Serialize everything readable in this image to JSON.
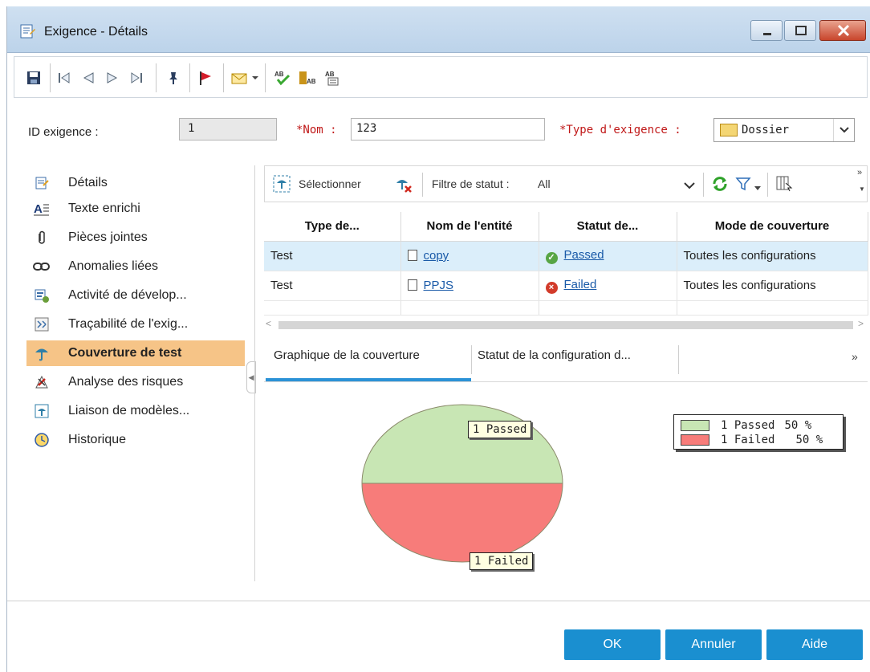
{
  "window": {
    "title": "Exigence - Détails",
    "buttons": [
      "minimize",
      "maximize",
      "close"
    ]
  },
  "toolbar": {
    "icons": [
      "save-icon",
      "first-icon",
      "previous-icon",
      "next-icon",
      "last-icon",
      "pin-icon",
      "flag-icon",
      "mail-icon",
      "spell-check-icon",
      "thesaurus-icon",
      "spell-options-icon"
    ]
  },
  "fields": {
    "id_label": "ID exigence :",
    "id_value": "1",
    "nom_label": "*Nom :",
    "nom_value": "123",
    "type_label": "*Type d'exigence :",
    "type_value": "Dossier"
  },
  "sidebar": {
    "items": [
      {
        "label": "Détails",
        "icon": "details-icon"
      },
      {
        "label": "Texte enrichi",
        "icon": "rich-text-icon"
      },
      {
        "label": "Pièces jointes",
        "icon": "paperclip-icon"
      },
      {
        "label": "Anomalies liées",
        "icon": "linked-defects-icon"
      },
      {
        "label": "Activité de dévelop...",
        "icon": "dev-activity-icon"
      },
      {
        "label": "Traçabilité de l'exig...",
        "icon": "traceability-icon"
      },
      {
        "label": "Couverture de test",
        "icon": "test-coverage-icon"
      },
      {
        "label": "Analyse des risques",
        "icon": "risk-analysis-icon"
      },
      {
        "label": "Liaison de modèles...",
        "icon": "model-link-icon"
      },
      {
        "label": "Historique",
        "icon": "history-icon"
      }
    ],
    "active_index": 6
  },
  "coverage_toolbar": {
    "select_label": "Sélectionner",
    "filter_label": "Filtre de statut :",
    "filter_value": "All"
  },
  "grid": {
    "headers": [
      "Type de...",
      "Nom de l'entité",
      "Statut de...",
      "Mode de couverture"
    ],
    "rows": [
      {
        "type": "Test",
        "name": "copy",
        "status": "Passed",
        "mode": "Toutes les configurations"
      },
      {
        "type": "Test",
        "name": "PPJS",
        "status": "Failed",
        "mode": "Toutes les configurations"
      }
    ]
  },
  "tabs": {
    "items": [
      "Graphique de la couverture",
      "Statut de la configuration d..."
    ],
    "active_index": 0
  },
  "chart_data": {
    "type": "pie",
    "labels": [
      "Passed",
      "Failed"
    ],
    "values": [
      1,
      1
    ],
    "percent": [
      50,
      50
    ],
    "slice_labels": [
      "1 Passed",
      "1 Failed"
    ],
    "legend": [
      {
        "text": "1 Passed",
        "pct": "50 %"
      },
      {
        "text": "1 Failed",
        "pct": "50 %"
      }
    ],
    "colors": [
      "#c8e6b4",
      "#f77c7a"
    ],
    "legend_position": "top-right"
  },
  "buttons": {
    "ok": "OK",
    "cancel": "Annuler",
    "help": "Aide"
  }
}
